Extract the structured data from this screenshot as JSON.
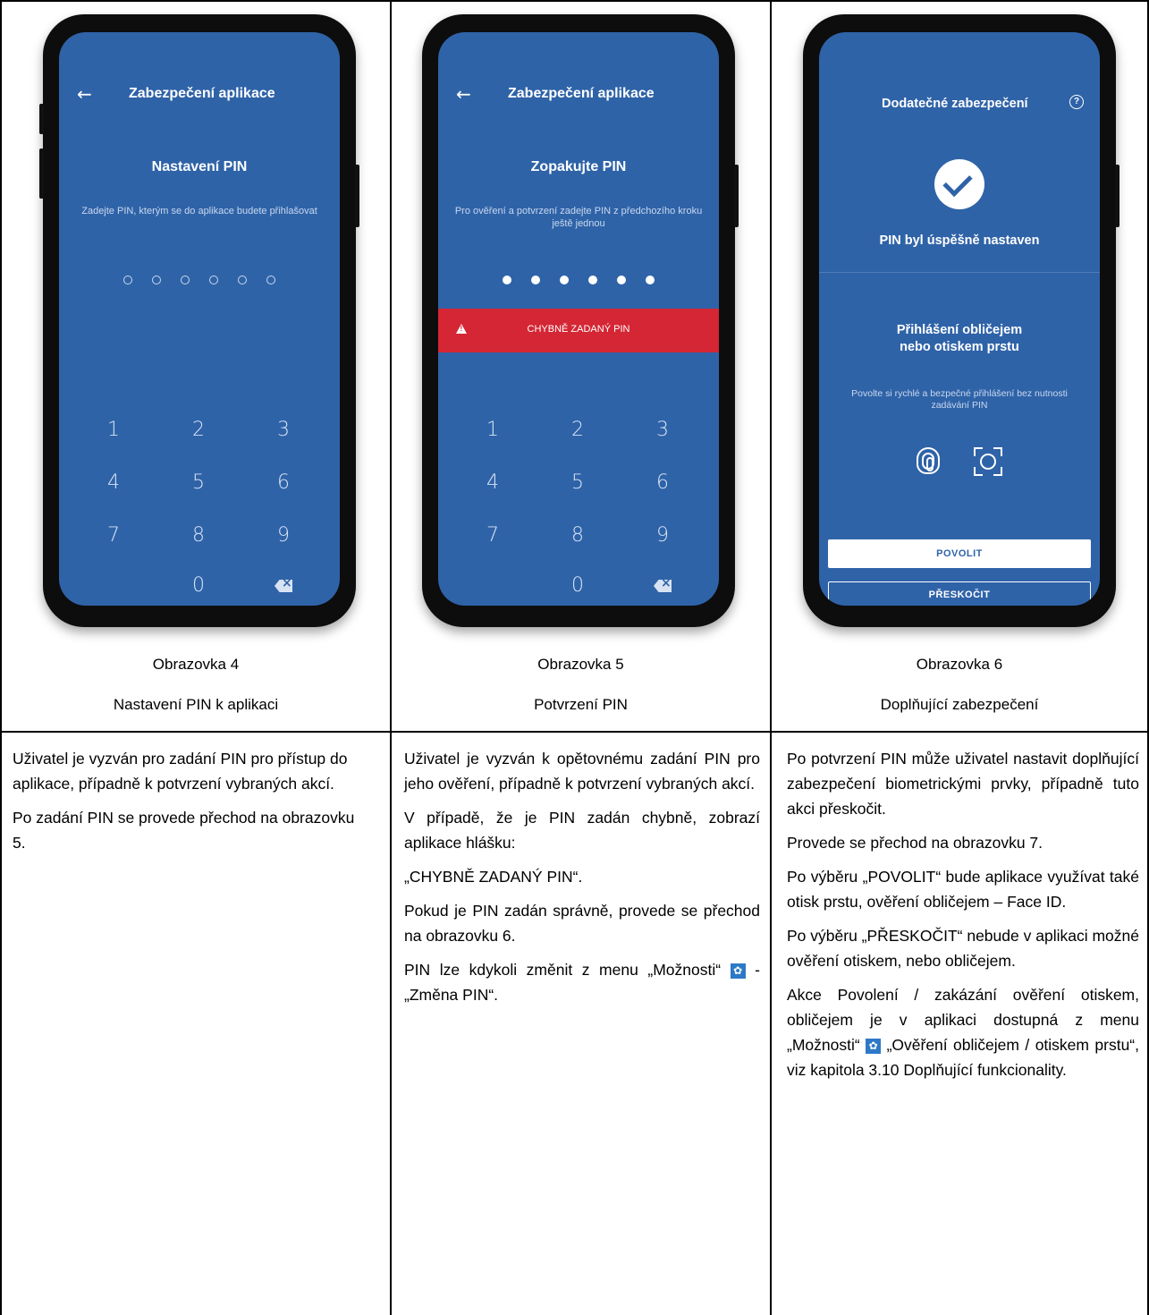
{
  "screens": [
    {
      "appbar_title": "Zabezpečení aplikace",
      "heading": "Nastavení PIN",
      "subtitle": "Zadejte PIN, kterým se do aplikace budete přihlašovat",
      "pin_dots_filled": 0,
      "keypad": [
        "1",
        "2",
        "3",
        "4",
        "5",
        "6",
        "7",
        "8",
        "9",
        "0"
      ],
      "caption_title": "Obrazovka 4",
      "caption_sub": "Nastavení PIN k aplikaci"
    },
    {
      "appbar_title": "Zabezpečení aplikace",
      "heading": "Zopakujte PIN",
      "subtitle": "Pro ověření a potvrzení zadejte PIN z předchozího kroku ještě jednou",
      "pin_dots_filled": 6,
      "error_text": "CHYBNĚ ZADANÝ PIN",
      "keypad": [
        "1",
        "2",
        "3",
        "4",
        "5",
        "6",
        "7",
        "8",
        "9",
        "0"
      ],
      "caption_title": "Obrazovka 5",
      "caption_sub": "Potvrzení PIN"
    },
    {
      "appbar_title": "Dodatečné zabezpečení",
      "help_glyph": "?",
      "success_text": "PIN byl úspěšně nastaven",
      "bio_heading": "Přihlášení obličejem nebo otiskem prstu",
      "bio_sub": "Povolte si rychlé a bezpečné přihlášení bez nutnosti zadávání PIN",
      "allow_label": "POVOLIT",
      "skip_label": "PŘESKOČIT",
      "caption_title": "Obrazovka 6",
      "caption_sub": "Doplňující zabezpečení"
    }
  ],
  "descriptions": {
    "col1": {
      "p1": "Uživatel je vyzván pro zadání PIN pro přístup do aplikace, případně k potvrzení vybraných akcí.",
      "p2": "Po zadání PIN se provede přechod na obrazovku 5."
    },
    "col2": {
      "p1": "Uživatel je vyzván k opětovnému zadání PIN pro jeho ověření, případně k potvrzení vybraných akcí.",
      "p2": "V případě, že je PIN zadán chybně, zobrazí aplikace hlášku:",
      "p3": "„CHYBNĚ ZADANÝ PIN“.",
      "p4": "Pokud je PIN zadán správně, provede se přechod na obrazovku 6.",
      "p5_a": "PIN lze kdykoli změnit z menu „Možnosti“",
      "p5_b": " - „Změna PIN“."
    },
    "col3": {
      "p1": "Po potvrzení PIN může uživatel nastavit doplňující zabezpečení biometrickými prvky, případně tuto akci přeskočit.",
      "p2": "Provede se přechod na obrazovku 7.",
      "p3": "Po výběru „POVOLIT“ bude aplikace využívat také otisk prstu, ověření obličejem – Face ID.",
      "p4": "Po výběru „PŘESKOČIT“ nebude v aplikaci možné ověření otiskem, nebo obličejem.",
      "p5_a": "Akce Povolení / zakázání ověření otiskem, obličejem je v aplikaci dostupná z menu „Možnosti“",
      "p5_b": "„Ověření obličejem / otiskem prstu“, viz kapitola 3.10 Doplňující funkcionality."
    }
  },
  "icons": {
    "back": "arrow-left-icon",
    "backspace": "backspace-icon",
    "warning": "warning-icon",
    "help": "help-circle-icon",
    "success": "check-circle-icon",
    "fingerprint": "fingerprint-icon",
    "face": "face-id-icon",
    "settings": "gear-icon"
  },
  "colors": {
    "screen_blue": "#2f63a8",
    "error_red": "#d42634",
    "gear_badge": "#2d79c7"
  }
}
